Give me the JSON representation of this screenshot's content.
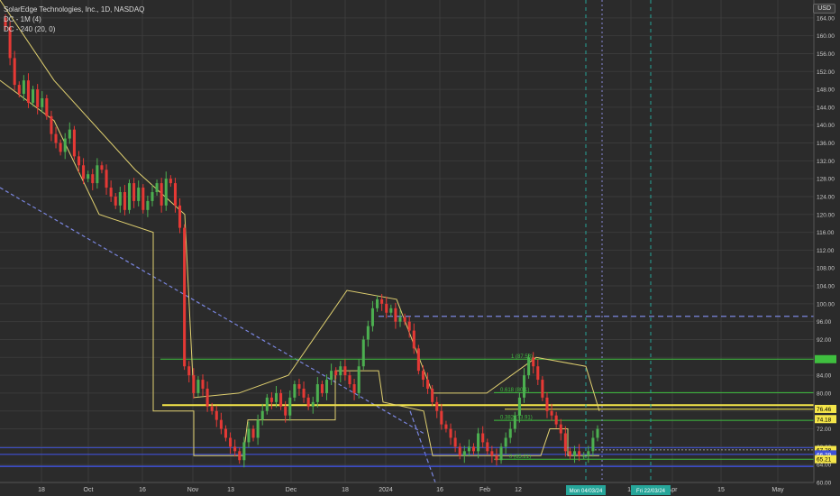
{
  "legend": {
    "title": "SolarEdge Technologies, Inc., 1D, NASDAQ",
    "line1": "DC - 1M (4)",
    "line2": "DC - 240 (20, 0)"
  },
  "currency": "USD",
  "colors": {
    "background": "#2b2b2b",
    "grid": "#3b3b3b",
    "up": "#4caf50",
    "down": "#e53935",
    "channel": "#e0d070",
    "fib_green": "#3fbf3f",
    "support_yellow": "#f5e64a",
    "blue_line": "#3f51d8",
    "dashed_blue": "#7a86e0",
    "dashed_teal": "#26a69a"
  },
  "fib_labels": [
    "1 (87.58)",
    "0.618 (80.1)",
    "0.382 (73.91)",
    "0 (65.21)"
  ],
  "price_tags": [
    {
      "text": "76.46",
      "price": 76.46,
      "bg": "#f5e64a",
      "fg": "#000"
    },
    {
      "text": "74.18",
      "price": 74.18,
      "bg": "#f5e64a",
      "fg": "#000"
    },
    {
      "text": "67.28",
      "price": 67.28,
      "bg": "#f5e64a",
      "fg": "#000"
    },
    {
      "text": "66.29",
      "price": 66.29,
      "bg": "#3f51d8",
      "fg": "#fff"
    },
    {
      "text": "65.21",
      "price": 65.21,
      "bg": "#f5e64a",
      "fg": "#000"
    }
  ],
  "date_tags": [
    {
      "text": "Mon 04/03/24",
      "x": 650
    },
    {
      "text": "Fri 22/03/24",
      "x": 722
    }
  ],
  "chart_data": {
    "type": "candlestick",
    "title": "SolarEdge Technologies, Inc., 1D, NASDAQ",
    "ylim": [
      60,
      168
    ],
    "y_ticks": [
      60,
      64,
      68,
      72,
      76,
      80,
      84,
      88,
      92,
      96,
      100,
      104,
      108,
      112,
      116,
      120,
      124,
      128,
      132,
      136,
      140,
      144,
      148,
      152,
      156,
      160,
      164
    ],
    "y_tick_labels": [
      "60.00",
      "64.00",
      "68.00",
      "72.00",
      "76.00",
      "80.00",
      "84.00",
      "88.00",
      "92.00",
      "96.00",
      "100.00",
      "104.00",
      "108.00",
      "112.00",
      "116.00",
      "120.00",
      "124.00",
      "128.00",
      "132.00",
      "136.00",
      "140.00",
      "144.00",
      "148.00",
      "152.00",
      "156.00",
      "160.00",
      "164.00"
    ],
    "x_ticks": [
      {
        "label": "18",
        "x": 46
      },
      {
        "label": "Oct",
        "x": 98
      },
      {
        "label": "16",
        "x": 158
      },
      {
        "label": "Nov",
        "x": 214
      },
      {
        "label": "13",
        "x": 256
      },
      {
        "label": "Dec",
        "x": 323
      },
      {
        "label": "18",
        "x": 383
      },
      {
        "label": "2024",
        "x": 428
      },
      {
        "label": "16",
        "x": 488
      },
      {
        "label": "Feb",
        "x": 538
      },
      {
        "label": "12",
        "x": 575
      },
      {
        "label": "18",
        "x": 700
      },
      {
        "label": "Apr",
        "x": 746
      },
      {
        "label": "15",
        "x": 800
      },
      {
        "label": "May",
        "x": 863
      }
    ],
    "closes": [
      162,
      155,
      149,
      147,
      150,
      145,
      148,
      144,
      146,
      142,
      138,
      136,
      134,
      137,
      139,
      133,
      131,
      128,
      129,
      127,
      131,
      130,
      126,
      124,
      122,
      125,
      121,
      127,
      123,
      126,
      121,
      123,
      125,
      127,
      122,
      128,
      127,
      122,
      117,
      86,
      84,
      80,
      83,
      81,
      77,
      76,
      74,
      72,
      70,
      68,
      67,
      65,
      69,
      72,
      70,
      74,
      76,
      79,
      78,
      80,
      77,
      75,
      79,
      82,
      81,
      79,
      77,
      78,
      82,
      80,
      83,
      85,
      84,
      86,
      84,
      82,
      80,
      86,
      92,
      95,
      99,
      101,
      100,
      98,
      99,
      96,
      97,
      96,
      94,
      90,
      85,
      83,
      81,
      78,
      76,
      73,
      72,
      70,
      68,
      66,
      67,
      68,
      67,
      71,
      69,
      67,
      66,
      65,
      68,
      70,
      72,
      75,
      79,
      84,
      88,
      86,
      83,
      79,
      76,
      75,
      73,
      71,
      67,
      66,
      67,
      66,
      66,
      67,
      70,
      72
    ],
    "channel": [
      {
        "x": 0,
        "price": 168
      },
      {
        "x": 60,
        "price": 150
      },
      {
        "x": 150,
        "price": 130
      },
      {
        "x": 205,
        "price": 120
      },
      {
        "x": 215,
        "price": 79
      },
      {
        "x": 265,
        "price": 80
      },
      {
        "x": 320,
        "price": 84
      },
      {
        "x": 385,
        "price": 103
      },
      {
        "x": 440,
        "price": 101
      },
      {
        "x": 480,
        "price": 80
      },
      {
        "x": 540,
        "price": 80
      },
      {
        "x": 595,
        "price": 88
      },
      {
        "x": 650,
        "price": 86
      },
      {
        "x": 665,
        "price": 76
      }
    ]
  }
}
